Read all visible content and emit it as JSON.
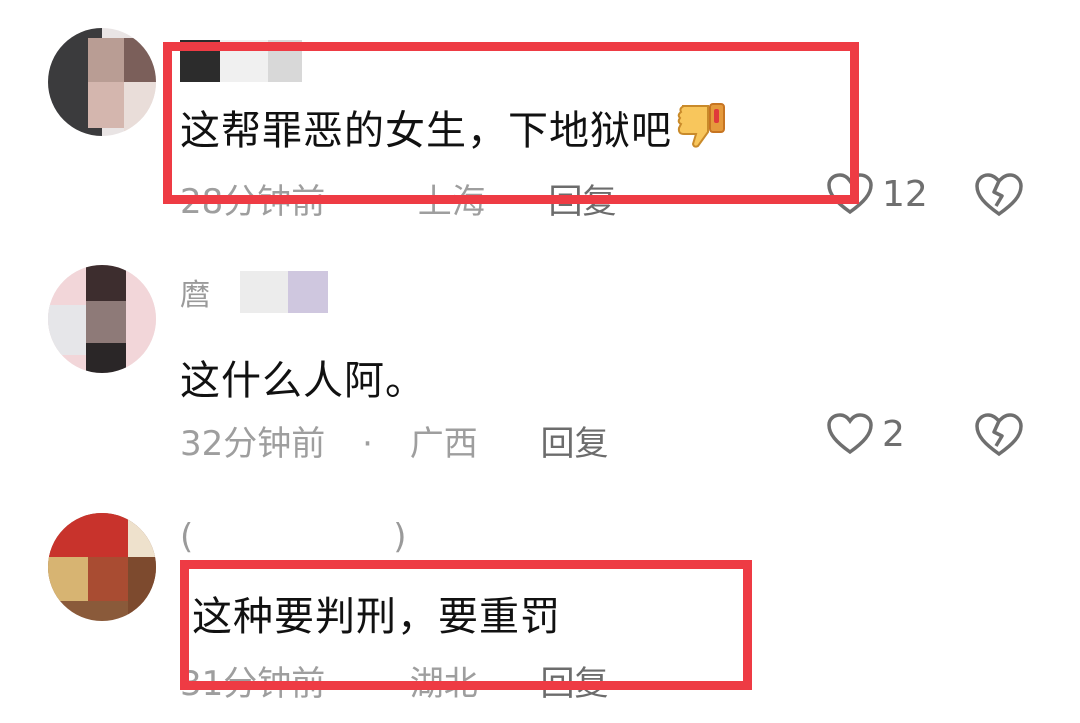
{
  "comments": [
    {
      "text": "这帮罪恶的女生，下地狱吧",
      "time": "28分钟前",
      "separator": "·",
      "location": "上海",
      "reply": "回复",
      "likes": "12"
    },
    {
      "username": "麿",
      "text": "这什么人阿。",
      "time": "32分钟前",
      "separator": "·",
      "location": "广西",
      "reply": "回复",
      "likes": "2"
    },
    {
      "username_open": "(",
      "username_close": ")",
      "text": "这种要判刑，要重罚",
      "time": "31分钟前",
      "separator": "·",
      "location": "湖北",
      "reply": "回复"
    }
  ],
  "icons": {
    "like": "heart-outline-icon",
    "dislike": "broken-heart-icon",
    "emoji": "thumbs-down-emoji"
  },
  "colors": {
    "highlight": "#ee3b44",
    "meta": "#9e9e9e",
    "text": "#111111"
  }
}
